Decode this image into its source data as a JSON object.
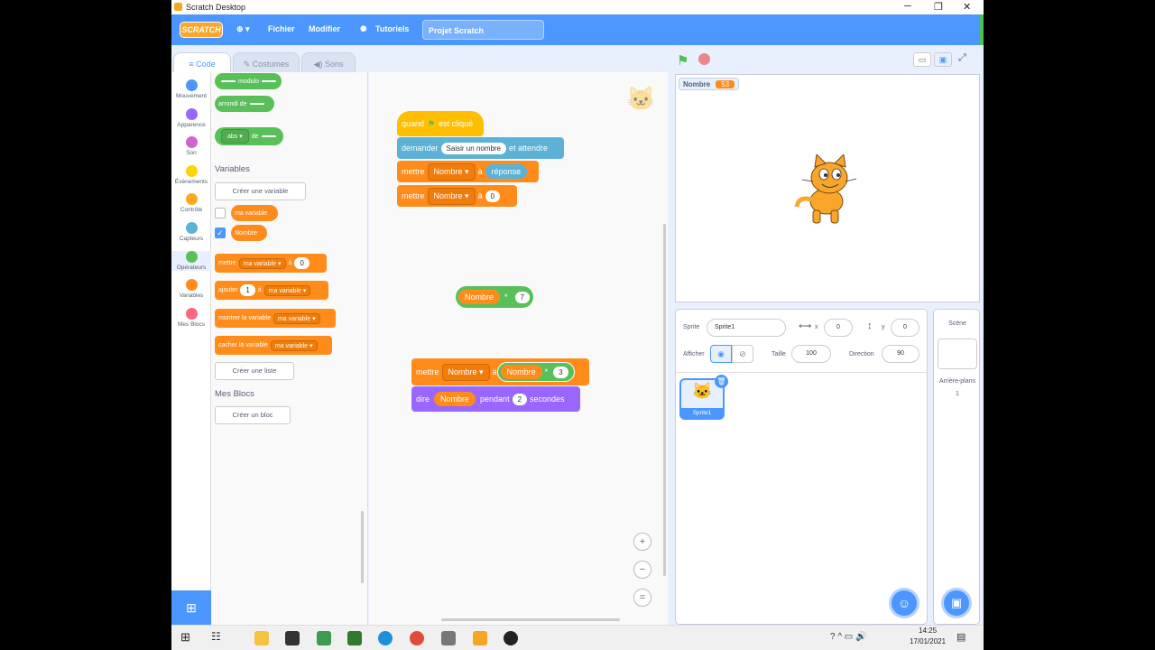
{
  "window": {
    "title": "Scratch Desktop",
    "min": "─",
    "max": "❐",
    "close": "✕"
  },
  "menu": {
    "logo": "SCRATCH",
    "globe": "⊕ ▾",
    "file": "Fichier",
    "edit": "Modifier",
    "tutorials": "Tutoriels",
    "project_name": "Projet Scratch"
  },
  "tabs": {
    "code": "Code",
    "costumes": "Costumes",
    "sounds": "Sons"
  },
  "categories": [
    {
      "label": "Mouvement",
      "color": "#4c97ff"
    },
    {
      "label": "Apparence",
      "color": "#9966ff"
    },
    {
      "label": "Son",
      "color": "#cf63cf"
    },
    {
      "label": "Événements",
      "color": "#ffd500"
    },
    {
      "label": "Contrôle",
      "color": "#ffab19"
    },
    {
      "label": "Capteurs",
      "color": "#5cb1d6"
    },
    {
      "label": "Opérateurs",
      "color": "#59c059"
    },
    {
      "label": "Variables",
      "color": "#ff8c1a"
    },
    {
      "label": "Mes Blocs",
      "color": "#ff6680"
    }
  ],
  "palette": {
    "modulo": "modulo",
    "round": "arrondi de",
    "abs": "abs",
    "abs_of": "de",
    "variables_heading": "Variables",
    "create_variable": "Créer une variable",
    "var1": "ma variable",
    "var2": "Nombre",
    "set": "mettre",
    "set_to": "à",
    "set_val": "0",
    "change": "ajouter",
    "change_val": "1",
    "change_to": "à",
    "show_var": "montrer la variable",
    "hide_var": "cacher la variable",
    "create_list": "Créer une liste",
    "myblocks_heading": "Mes Blocs",
    "create_block": "Créer un bloc"
  },
  "script": {
    "when": "quand",
    "clicked": "est cliqué",
    "ask": "demander",
    "ask_text": "Saisir un nombre",
    "and_wait": "et attendre",
    "set1": "mettre",
    "var": "Nombre",
    "to": "à",
    "answer": "réponse",
    "zero": "0",
    "mult_left": "Nombre",
    "mult_op": "*",
    "mult_right": "7",
    "set3": "mettre",
    "set3_var": "Nombre",
    "set3_to": "à",
    "inner_var": "Nombre",
    "inner_op": "*",
    "inner_val": "3",
    "say": "dire",
    "say_var": "Nombre",
    "for": "pendant",
    "secs": "2",
    "seconds": "secondes"
  },
  "stage": {
    "monitor_label": "Nombre",
    "monitor_value": "53"
  },
  "sprite_info": {
    "sprite_label": "Sprite",
    "sprite_name": "Sprite1",
    "x_label": "x",
    "x": "0",
    "y_label": "y",
    "y": "0",
    "show_label": "Afficher",
    "size_label": "Taille",
    "size": "100",
    "dir_label": "Direction",
    "dir": "90"
  },
  "sprite_tile": {
    "name": "Sprite1"
  },
  "scene": {
    "label": "Scène",
    "backdrops_label": "Arrière-plans",
    "backdrops_count": "1"
  },
  "clock": {
    "time": "14:25",
    "date": "17/01/2021"
  }
}
